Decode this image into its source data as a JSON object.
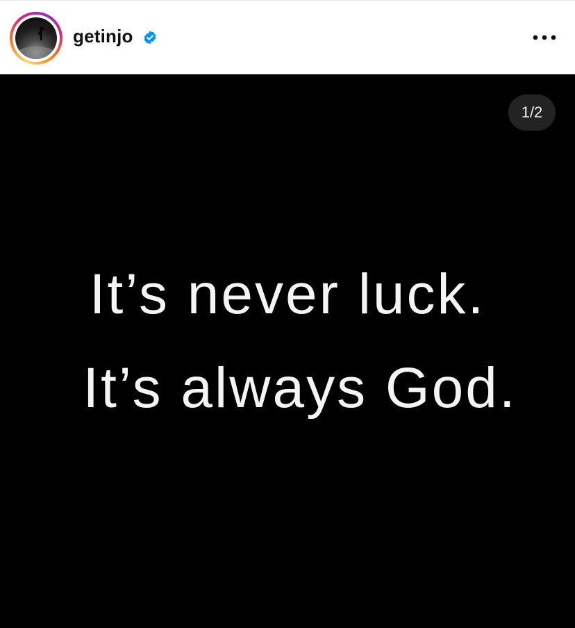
{
  "header": {
    "username": "getinjo",
    "verified_icon": "verified-badge-icon",
    "more_icon": "more-options-icon",
    "accent_color": "#0095f6"
  },
  "post": {
    "slide_counter": "1/2",
    "quote_line_1": "It’s never luck.",
    "quote_line_2": "It’s always God.",
    "background_color": "#000000"
  }
}
